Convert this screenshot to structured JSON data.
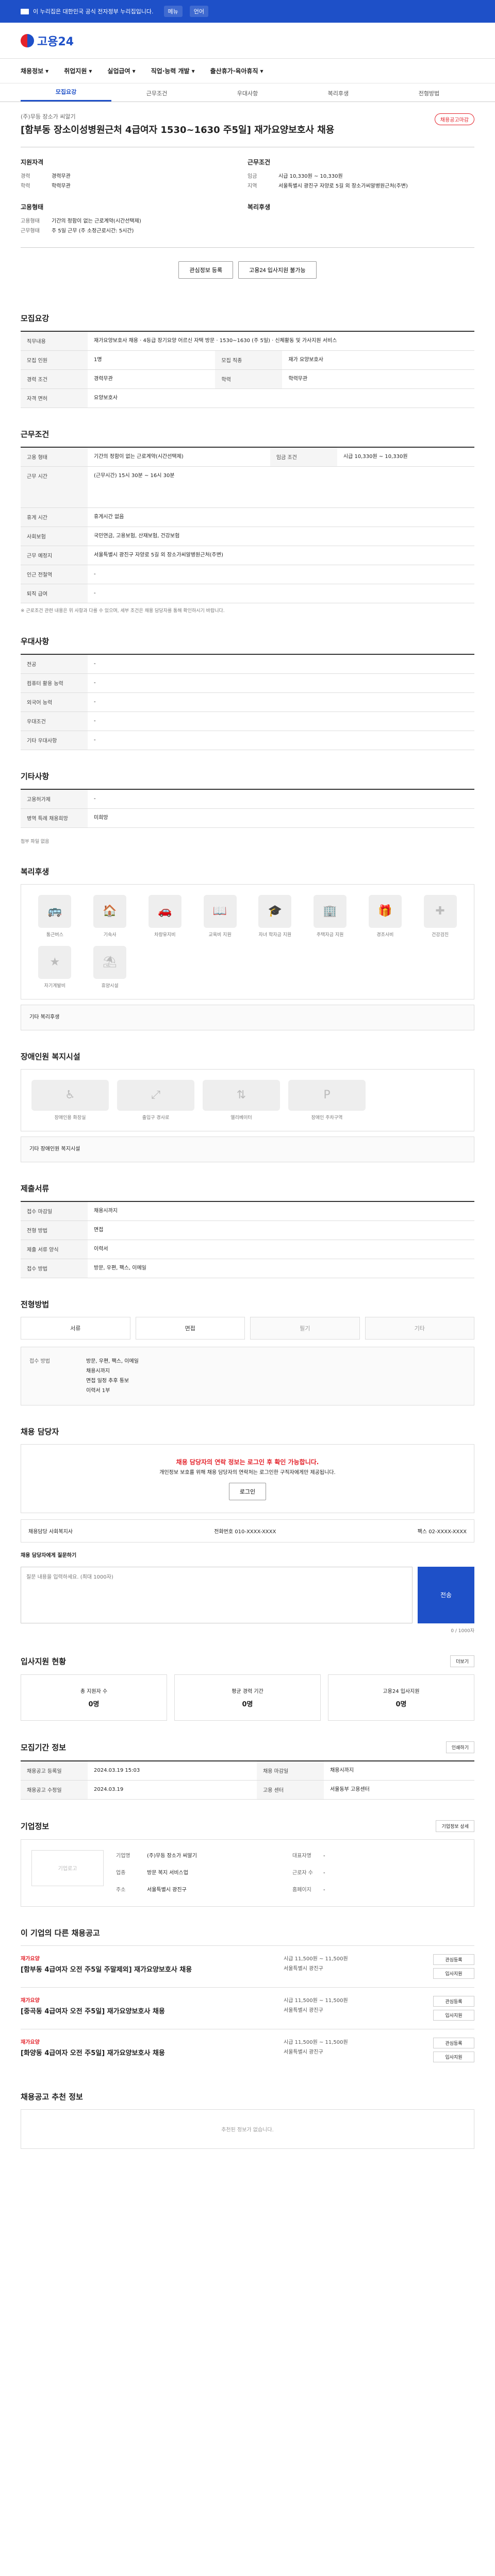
{
  "topbar": {
    "notice": "이 누리집은 대한민국 공식 전자정부 누리집입니다.",
    "links": [
      "메뉴",
      "언어"
    ]
  },
  "logo": {
    "name": "고용24"
  },
  "gnb": [
    "채용정보",
    "취업지원",
    "실업급여",
    "직업·능력 개발",
    "출산휴가·육아휴직"
  ],
  "tabs": [
    "모집요강",
    "근무조건",
    "우대사항",
    "복리후생",
    "전형방법"
  ],
  "job": {
    "company": "(주)무등 장소가 씨알기",
    "title": "[함부동 장소이성병원근처 4급여자 1530~1630 주5일] 재가요양보호사 채용",
    "badge": "채용공고마감"
  },
  "summary": {
    "left_title": "지원자격",
    "left": [
      {
        "k": "경력",
        "v": "경력무관"
      },
      {
        "k": "학력",
        "v": "학력무관"
      }
    ],
    "right_title": "근무조건",
    "right": [
      {
        "k": "임금",
        "v": "시급 10,330원 ~ 10,330원"
      },
      {
        "k": "지역",
        "v": "서울특별시 광진구 자양로 5길 외 장소가씨알병원근처(주변)"
      }
    ],
    "left2_title": "고용형태",
    "left2": [
      {
        "k": "고용형태",
        "v": "기간의 정함이 없는 근로계약(시간선택제)"
      },
      {
        "k": "근무형태",
        "v": "주 5일 근무 (주 소정근로시간: 5시간)"
      }
    ],
    "right2_title": "복리후생",
    "right2": []
  },
  "actions": {
    "print": "관심정보 등록",
    "apply": "고용24 입사지원 불가능"
  },
  "sections": {
    "recruit": {
      "title": "모집요강",
      "rows": [
        {
          "k": "직무내용",
          "v": "재가요양보호사 채용 · 4등급 장기요양 어르신 자택 방문 · 1530~1630 (주 5일) · 신체활동 및 가사지원 서비스"
        },
        {
          "k": "모집 인원",
          "v": "1명"
        },
        {
          "k": "모집 직종",
          "v": "재가 요양보호사"
        },
        {
          "k": "경력 조건",
          "v": "경력무관"
        },
        {
          "k": "학력",
          "v": "학력무관"
        },
        {
          "k": "자격 면허",
          "v": "요양보호사"
        }
      ]
    },
    "work": {
      "title": "근무조건",
      "rows": [
        {
          "k": "고용 형태",
          "v": "기간의 정함이 없는 근로계약(시간선택제)"
        },
        {
          "k": "임금 조건",
          "v": "시급 10,330원 ~ 10,330원"
        },
        {
          "k": "근무 시간",
          "v": "(근무시간) 15시 30분 ~ 16시 30분"
        },
        {
          "k": "휴게 시간",
          "v": "휴게시간 없음"
        },
        {
          "k": "사회보험",
          "v": "국민연금, 고용보험, 산재보험, 건강보험"
        },
        {
          "k": "근무 예정지",
          "v": "서울특별시 광진구 자양로 5길 외 장소가씨알병원근처(주변)"
        },
        {
          "k": "인근 전철역",
          "v": "-"
        },
        {
          "k": "퇴직 급여",
          "v": "-"
        }
      ],
      "note": "※ 근로조건 관련 내용은 위 사항과 다를 수 있으며, 세부 조건은 채용 담당자를 통해 확인하시기 바랍니다."
    },
    "prefer": {
      "title": "우대사항",
      "rows": [
        {
          "k": "전공",
          "v": "-"
        },
        {
          "k": "컴퓨터 활용 능력",
          "v": "-"
        },
        {
          "k": "외국어 능력",
          "v": "-"
        },
        {
          "k": "우대조건",
          "v": "-"
        },
        {
          "k": "기타 우대사항",
          "v": "-"
        }
      ]
    },
    "other": {
      "title": "기타사항",
      "rows": [
        {
          "k": "고용허가제",
          "v": "-"
        },
        {
          "k": "병역 특례 채용희망",
          "v": "미희망"
        }
      ],
      "link": "첨부 파일 없음"
    },
    "welfare": {
      "title": "복리후생",
      "items": [
        "통근버스",
        "기숙사",
        "차량유지비",
        "교육비 지원",
        "자녀 학자금 지원",
        "주택자금 지원",
        "경조사비",
        "건강검진",
        "자기계발비",
        "휴양시설"
      ],
      "note": "기타 복리후생"
    },
    "disability": {
      "title": "장애인원 복지시설",
      "items": [
        "장애인용 화장실",
        "출입구 경사로",
        "엘리베이터",
        "장애인 주차구역"
      ],
      "note": "기타 장애인원 복지시설"
    },
    "submit": {
      "title": "제출서류",
      "rows": [
        {
          "k": "접수 마감일",
          "v": "채용시까지"
        },
        {
          "k": "전형 방법",
          "v": "면접"
        },
        {
          "k": "제출 서류 양식",
          "v": "이력서"
        },
        {
          "k": "접수 방법",
          "v": "방문, 우편, 팩스, 이메일"
        }
      ]
    },
    "method": {
      "title": "전형방법",
      "options": [
        "서류",
        "면접",
        "필기",
        "기타"
      ],
      "apply_by": "접수 방법",
      "apply_val": "방문, 우편, 팩스, 이메일",
      "deadline": "채용시까지",
      "interview": "면접 일정 추후 통보",
      "docs": "이력서 1부"
    },
    "contact": {
      "title": "채용 담당자",
      "warn": "채용 담당자의 연락 정보는 로그인 후 확인 가능합니다.",
      "desc": "개인정보 보호를 위해 채용 담당자의 연락처는 로그인한 구직자에게만 제공됩니다.",
      "login": "로그인",
      "manager_label": "채용담당 사회복지사",
      "manager_phone": "전화번호 010-XXXX-XXXX",
      "manager_fax": "팩스 02-XXXX-XXXX",
      "ask_label": "채용 담당자에게 질문하기",
      "placeholder": "질문 내용을 입력하세요. (최대 1000자)",
      "send": "전송",
      "counter": "0 / 1000자"
    },
    "stats": {
      "title": "입사지원 현황",
      "more": "더보기",
      "items": [
        {
          "label": "총 지원자 수",
          "value": "0명"
        },
        {
          "label": "평균 경력 기간",
          "value": "0명"
        },
        {
          "label": "고용24 입사지원",
          "value": "0명"
        }
      ]
    },
    "period": {
      "title": "모집기간 정보",
      "print": "인쇄하기",
      "rows": [
        {
          "k": "채용공고 등록일",
          "v": "2024.03.19 15:03"
        },
        {
          "k": "채용 마감일",
          "v": "채용시까지"
        },
        {
          "k": "채용공고 수정일",
          "v": "2024.03.19"
        },
        {
          "k": "고용 센터",
          "v": "서울동부 고용센터"
        }
      ]
    },
    "company": {
      "title": "기업정보",
      "logo": "기업로고",
      "fields": [
        {
          "k": "기업명",
          "v": "(주)무등 장소가 씨알기"
        },
        {
          "k": "대표자명",
          "v": "-"
        },
        {
          "k": "업종",
          "v": "방문 복지 서비스업"
        },
        {
          "k": "근로자 수",
          "v": "-"
        },
        {
          "k": "주소",
          "v": "서울특별시 광진구"
        },
        {
          "k": "홈페이지",
          "v": "-"
        }
      ],
      "detail": "기업정보 상세"
    },
    "similar": {
      "title": "이 기업의 다른 채용공고",
      "items": [
        {
          "co": "재가요양",
          "t": "[함부동 4급여자 오전 주5일 주말제외] 재가요양보호사 채용",
          "wage": "시급 11,500원 ~ 11,500원",
          "loc": "서울특별시 광진구"
        },
        {
          "co": "재가요양",
          "t": "[중곡동 4급여자 오전 주5일] 재가요양보호사 채용",
          "wage": "시급 11,500원 ~ 11,500원",
          "loc": "서울특별시 광진구"
        },
        {
          "co": "재가요양",
          "t": "[화양동 4급여자 오전 주5일] 재가요양보호사 채용",
          "wage": "시급 11,500원 ~ 11,500원",
          "loc": "서울특별시 광진구"
        }
      ],
      "btn_a": "관심등록",
      "btn_b": "입사지원"
    },
    "recommend": {
      "title": "채용공고 추천 정보",
      "empty": "추천된 정보가 없습니다."
    }
  }
}
